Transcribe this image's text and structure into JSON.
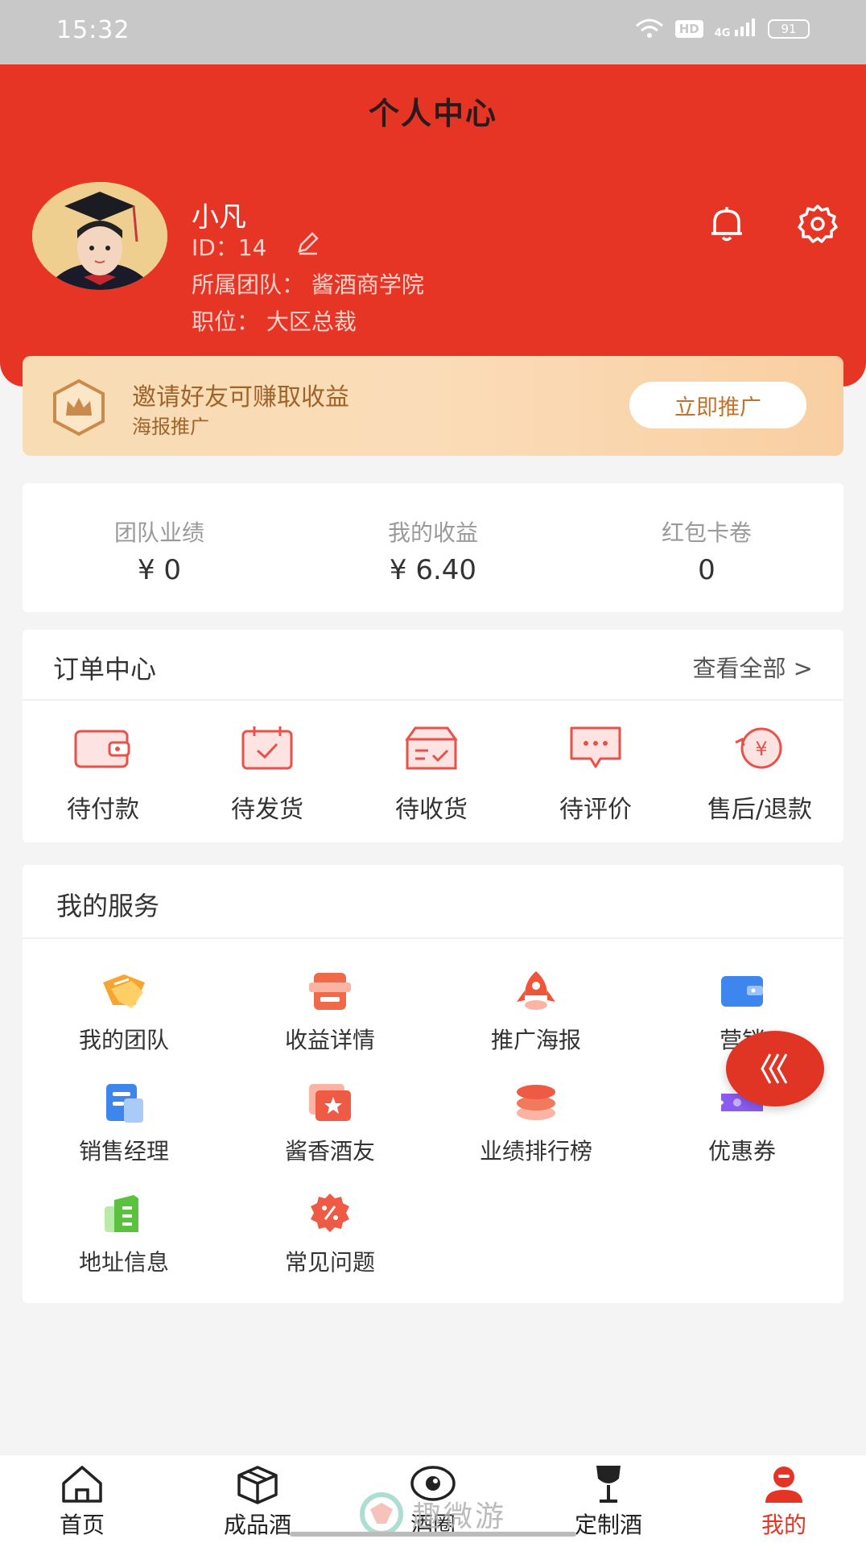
{
  "status_bar": {
    "time": "15:32",
    "hd": "HD",
    "signal": "4G",
    "battery": "91"
  },
  "header": {
    "title": "个人中心"
  },
  "profile": {
    "name": "小凡",
    "id_label": "ID：",
    "id_value": "14",
    "team": "所属团队：  酱酒商学院",
    "position": "职位：  大区总裁"
  },
  "invite": {
    "title": "邀请好友可赚取收益",
    "subtitle": "海报推广",
    "button": "立即推广"
  },
  "stats": [
    {
      "label": "团队业绩",
      "value": "¥ 0"
    },
    {
      "label": "我的收益",
      "value": "¥ 6.40"
    },
    {
      "label": "红包卡卷",
      "value": "0"
    }
  ],
  "orders": {
    "title": "订单中心",
    "view_all": "查看全部 >",
    "items": [
      {
        "label": "待付款",
        "icon": "wallet-icon"
      },
      {
        "label": "待发货",
        "icon": "calendar-check-icon"
      },
      {
        "label": "待收货",
        "icon": "box-icon"
      },
      {
        "label": "待评价",
        "icon": "chat-icon"
      },
      {
        "label": "售后/退款",
        "icon": "refund-icon"
      }
    ]
  },
  "services": {
    "title": "我的服务",
    "items": [
      {
        "label": "我的团队",
        "icon": "team-icon"
      },
      {
        "label": "收益详情",
        "icon": "earnings-icon"
      },
      {
        "label": "推广海报",
        "icon": "rocket-icon"
      },
      {
        "label": "营销",
        "icon": "marketing-icon"
      },
      {
        "label": "销售经理",
        "icon": "document-icon"
      },
      {
        "label": "酱香酒友",
        "icon": "star-card-icon"
      },
      {
        "label": "业绩排行榜",
        "icon": "coin-stack-icon"
      },
      {
        "label": "优惠券",
        "icon": "coupon-icon"
      },
      {
        "label": "地址信息",
        "icon": "address-icon"
      },
      {
        "label": "常见问题",
        "icon": "badge-percent-icon"
      }
    ]
  },
  "tabs": [
    {
      "label": "首页",
      "icon": "home-icon"
    },
    {
      "label": "成品酒",
      "icon": "package-icon"
    },
    {
      "label": "酒圈",
      "icon": "eye-circle-icon"
    },
    {
      "label": "定制酒",
      "icon": "wine-glass-icon"
    },
    {
      "label": "我的",
      "icon": "user-icon",
      "active": true
    }
  ],
  "watermark": {
    "text": "趣微游"
  },
  "colors": {
    "brand_red": "#e63525",
    "invite_text": "#a0642a",
    "active_tab": "#e53424"
  }
}
